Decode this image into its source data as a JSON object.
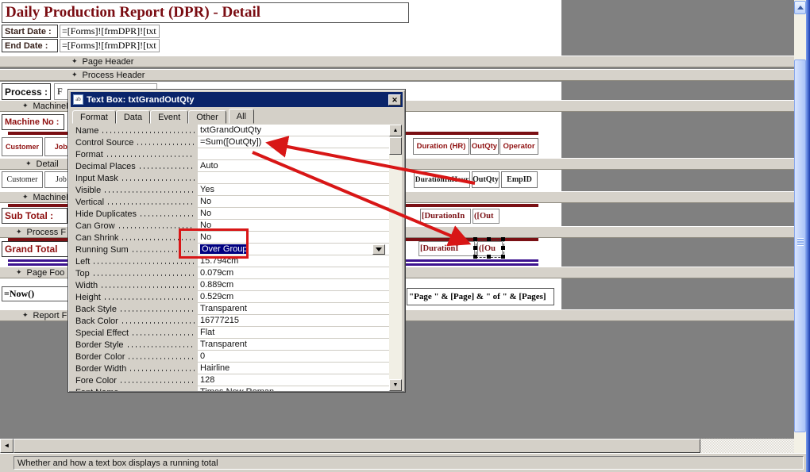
{
  "window": {
    "status_bar": "Whether and how a text box displays a running total"
  },
  "icons": {
    "section_glyph": "✦",
    "close": "✕",
    "scroll_up": "▲",
    "scroll_down": "▼",
    "left_arrow": "◄",
    "textbox_icon": "ab"
  },
  "report": {
    "title": "Daily Production Report (DPR) - Detail",
    "fields": {
      "start_date_label": "Start Date :",
      "start_date_value": "=[Forms]![frmDPR]![txt",
      "end_date_label": "End Date :",
      "end_date_value": "=[Forms]![frmDPR]![txt",
      "process_label": "Process :",
      "process_value": "F",
      "machine_no_label": "Machine No :",
      "sub_total_label": "Sub Total :",
      "grand_total_label": "Grand Total",
      "now_expression": "=Now()",
      "page_expression": "\"Page \" & [Page] & \" of \" & [Pages]"
    },
    "section_bars": [
      {
        "id": "page-header",
        "label": "Page Header"
      },
      {
        "id": "process-header",
        "label": "Process Header"
      },
      {
        "id": "machine-header",
        "label": "MachineI"
      },
      {
        "id": "detail",
        "label": "Detail"
      },
      {
        "id": "machine-footer",
        "label": "MachineI"
      },
      {
        "id": "process-footer",
        "label": "Process F"
      },
      {
        "id": "page-footer",
        "label": "Page Foo"
      },
      {
        "id": "report-footer",
        "label": "Report F"
      }
    ],
    "columns": {
      "header": [
        "Customer",
        "Job Co",
        "Duration (HR)",
        "OutQty",
        "Operator"
      ],
      "detail": [
        "Customer",
        "Job Co",
        "DurationInHour",
        "OutQty",
        "EmpID"
      ],
      "sub_total": [
        "[DurationIn",
        "([Out"
      ],
      "grand_total": [
        "[DurationI",
        "([Ou"
      ]
    }
  },
  "dialog": {
    "title": "Text Box: txtGrandOutQty",
    "tabs": [
      "Format",
      "Data",
      "Event",
      "Other",
      "All"
    ],
    "active_tab": "All",
    "properties": [
      {
        "label": "Name",
        "value": "txtGrandOutQty"
      },
      {
        "label": "Control Source",
        "value": "=Sum([OutQty])"
      },
      {
        "label": "Format",
        "value": ""
      },
      {
        "label": "Decimal Places",
        "value": "Auto"
      },
      {
        "label": "Input Mask",
        "value": ""
      },
      {
        "label": "Visible",
        "value": "Yes"
      },
      {
        "label": "Vertical",
        "value": "No"
      },
      {
        "label": "Hide Duplicates",
        "value": "No"
      },
      {
        "label": "Can Grow",
        "value": "No"
      },
      {
        "label": "Can Shrink",
        "value": "No"
      },
      {
        "label": "Running Sum",
        "value": "Over Group",
        "highlighted": true,
        "dropdown": true
      },
      {
        "label": "Left",
        "value": "15.794cm"
      },
      {
        "label": "Top",
        "value": "0.079cm"
      },
      {
        "label": "Width",
        "value": "0.889cm"
      },
      {
        "label": "Height",
        "value": "0.529cm"
      },
      {
        "label": "Back Style",
        "value": "Transparent"
      },
      {
        "label": "Back Color",
        "value": "16777215"
      },
      {
        "label": "Special Effect",
        "value": "Flat"
      },
      {
        "label": "Border Style",
        "value": "Transparent"
      },
      {
        "label": "Border Color",
        "value": "0"
      },
      {
        "label": "Border Width",
        "value": "Hairline"
      },
      {
        "label": "Fore Color",
        "value": "128"
      },
      {
        "label": "Font Name",
        "value": "Times New Roman"
      }
    ]
  },
  "colors": {
    "annotation_red": "#d81616",
    "title_maroon": "#7a0c12",
    "dark_red_line": "#7a1014",
    "purple_line": "#3c128f",
    "titlebar_blue": "#0a246a",
    "selection_navy": "#000080",
    "chrome_gray": "#d4d0c8",
    "canvas_outside": "#808080"
  }
}
